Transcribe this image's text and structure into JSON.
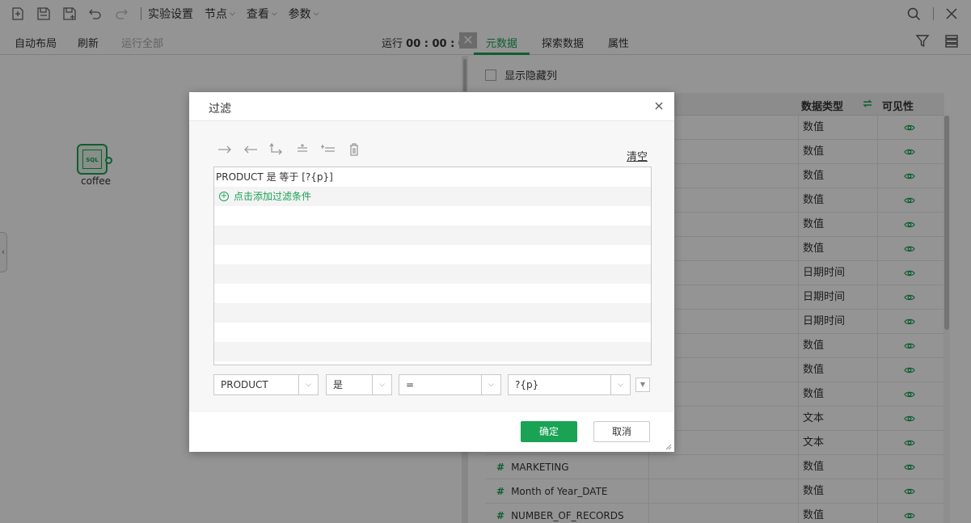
{
  "menus": [
    {
      "label": "实验设置",
      "has_chevron": false
    },
    {
      "label": "节点",
      "has_chevron": true
    },
    {
      "label": "查看",
      "has_chevron": true
    },
    {
      "label": "参数",
      "has_chevron": true
    }
  ],
  "subbar": {
    "auto_layout": "自动布局",
    "refresh": "刷新",
    "run_all": "运行全部",
    "run_label": "运行",
    "run_time": "00 : 00 : 00"
  },
  "tabs": [
    "元数据",
    "探索数据",
    "属性"
  ],
  "canvas": {
    "node_label": "coffee",
    "node_inner_text": "SQL"
  },
  "panel": {
    "show_hidden": "显示隐藏列",
    "col_type": "数据类型",
    "col_visibility": "可见性",
    "rows": [
      {
        "name": "",
        "type": "数值"
      },
      {
        "name": "",
        "type": "数值"
      },
      {
        "name": "",
        "type": "数值"
      },
      {
        "name": "",
        "type": "数值"
      },
      {
        "name": "",
        "type": "数值"
      },
      {
        "name": "",
        "type": "数值"
      },
      {
        "name": "",
        "type": "日期时间"
      },
      {
        "name": "",
        "type": "日期时间"
      },
      {
        "name": "",
        "type": "日期时间"
      },
      {
        "name": "",
        "type": "数值"
      },
      {
        "name": "",
        "type": "数值"
      },
      {
        "name": "",
        "type": "数值"
      },
      {
        "name": "",
        "type": "文本"
      },
      {
        "name": "",
        "type": "文本"
      },
      {
        "name": "MARKETING",
        "type": "数值"
      },
      {
        "name": "Month of Year_DATE",
        "type": "数值"
      },
      {
        "name": "NUMBER_OF_RECORDS",
        "type": "数值"
      }
    ]
  },
  "dialog": {
    "title": "过滤",
    "clear": "清空",
    "condition": "PRODUCT 是 等于 [?{p}]",
    "add_condition": "点击添加过滤条件",
    "field": "PRODUCT",
    "mode": "是",
    "operator": "=",
    "value": "?{p}",
    "ok": "确定",
    "cancel": "取消"
  },
  "colors": {
    "accent": "#1aa255"
  }
}
